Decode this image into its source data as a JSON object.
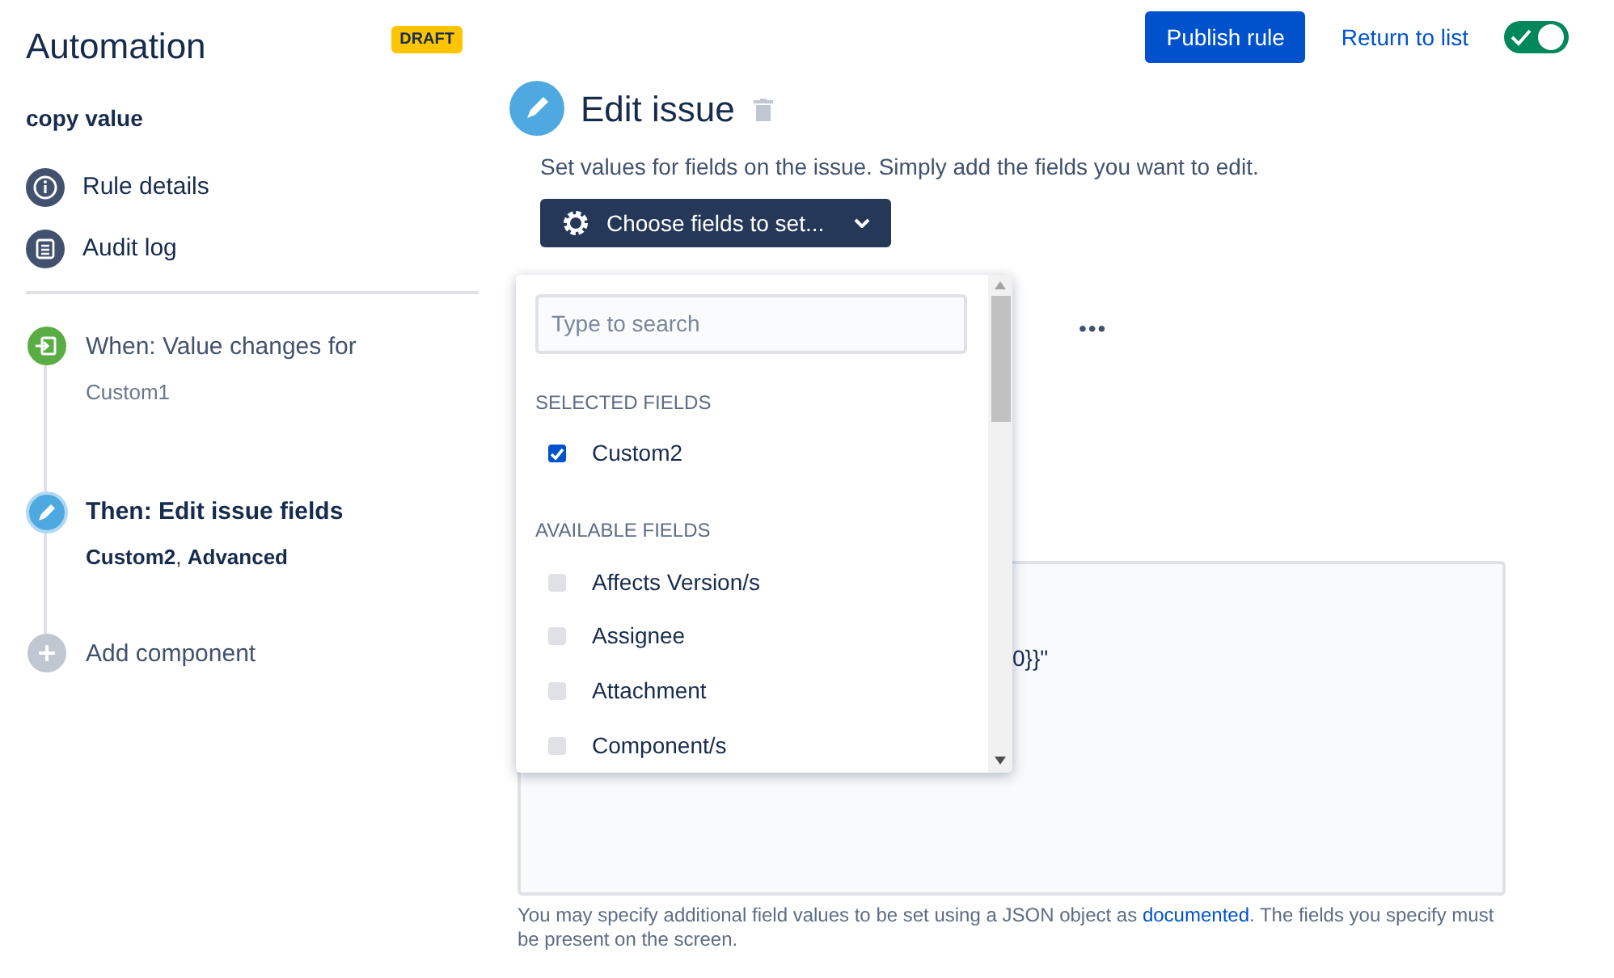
{
  "header": {
    "title": "Automation",
    "badge": "DRAFT",
    "publish_button": "Publish rule",
    "return_link": "Return to list",
    "enabled": true
  },
  "sidebar": {
    "rule_name": "copy value",
    "nav": [
      {
        "kind": "info",
        "label": "Rule details"
      },
      {
        "kind": "log",
        "label": "Audit log"
      }
    ],
    "steps": [
      {
        "kind": "trigger",
        "title": "When: Value changes for",
        "detail": "Custom1",
        "selected": false
      },
      {
        "kind": "action",
        "title": "Then: Edit issue fields",
        "detail": "**Custom2**, **Advanced**",
        "selected": true
      },
      {
        "kind": "add",
        "title": "Add component",
        "selected": false
      }
    ]
  },
  "main": {
    "title": "Edit issue",
    "description": "Set values for fields on the issue. Simply add the fields you want to edit.",
    "choose_button": "Choose fields to set...",
    "dropdown": {
      "search_placeholder": "Type to search",
      "sections": [
        {
          "heading": "SELECTED FIELDS",
          "items": [
            {
              "label": "Custom2",
              "checked": true
            }
          ]
        },
        {
          "heading": "AVAILABLE FIELDS",
          "items": [
            {
              "label": "Affects Version/s",
              "checked": false
            },
            {
              "label": "Assignee",
              "checked": false
            },
            {
              "label": "Attachment",
              "checked": false
            },
            {
              "label": "Component/s",
              "checked": false
            }
          ]
        }
      ]
    },
    "more_menu": "•••",
    "advanced_value": "0}}\"",
    "help_text": "You may specify additional field values to be set using a JSON object as ",
    "help_link": "documented",
    "help_text_end": ". The fields you specify must be present on the screen."
  }
}
